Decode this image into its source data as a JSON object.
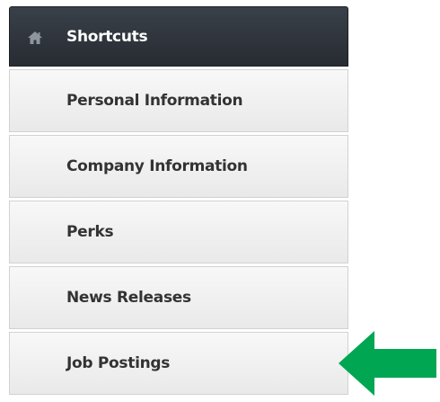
{
  "shortcuts": {
    "header_label": "Shortcuts",
    "header_icon": "home-icon",
    "items": [
      {
        "label": "Personal Information"
      },
      {
        "label": "Company Information"
      },
      {
        "label": "Perks"
      },
      {
        "label": "News Releases"
      },
      {
        "label": "Job Postings"
      }
    ]
  },
  "annotation": {
    "arrow_icon": "green-arrow-icon",
    "arrow_color": "#00a651"
  }
}
